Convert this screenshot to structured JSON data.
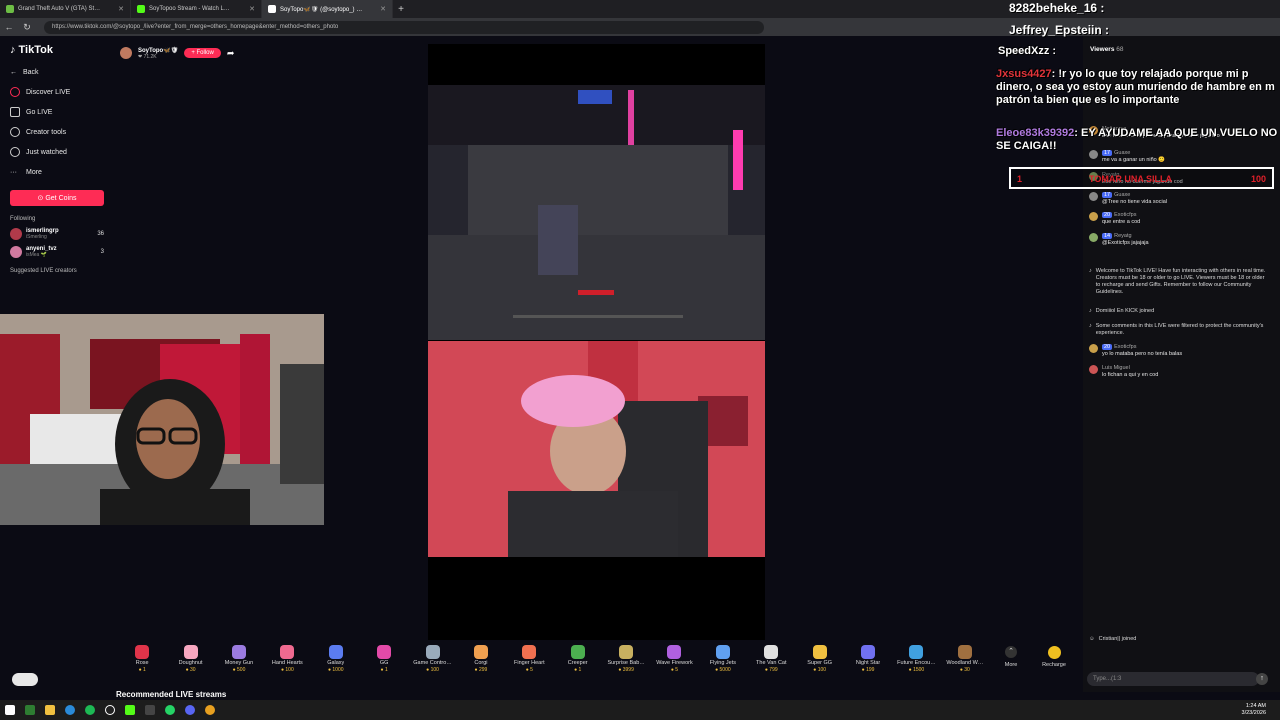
{
  "browser": {
    "tabs": [
      {
        "label": "Grand Theft Auto V (GTA) St…",
        "color": "#6dbd45"
      },
      {
        "label": "SoyTopoo Stream - Watch L…",
        "color": "#53fc18"
      },
      {
        "label": "SoyTopo🦋🛡 (@soytopo_) …",
        "color": "#ffffff"
      }
    ],
    "new_tab": "+",
    "url": "https://www.tiktok.com/@soytopo_/live?enter_from_merge=others_homepage&enter_method=others_photo"
  },
  "sidebar": {
    "logo": "TikTok",
    "back": "Back",
    "items": [
      "Discover LIVE",
      "Go LIVE",
      "Creator tools",
      "Just watched",
      "More"
    ],
    "get_coins": "Get Coins",
    "following_title": "Following",
    "following": [
      {
        "name": "ismerlingrp",
        "sub": "iSmerling",
        "count": "36"
      },
      {
        "name": "anyeni_tvz",
        "sub": "isMea 🌱",
        "count": "3"
      }
    ],
    "suggested_title": "Suggested LIVE creators"
  },
  "host": {
    "name": "SoyTopo🦋🛡",
    "likes": "❤ 71.2K",
    "follow_label": "+ Follow"
  },
  "top_overlay": [
    {
      "text": "8282beheke_16 :",
      "color": "#ffffff"
    },
    {
      "text": "Jeffrey_Epsteiin :",
      "color": "#ffffff"
    }
  ],
  "overlay_chat": [
    {
      "name": "SpeedXzz :",
      "text": "",
      "name_color": "#ffffff"
    },
    {
      "name": "Jxsus4427",
      "text": ": !r yo lo que toy relajado porque mi p dinero, o sea yo estoy aun muriendo de hambre en m patrón ta bien que es lo importante",
      "name_color": "#e0343a"
    },
    {
      "name": "Eleoe83k39392",
      "text": ": EY AYUDAME AA QUE UN VUELO NO SE CAIGA!!",
      "name_color": "#b07be0"
    }
  ],
  "overlay_box": {
    "left": "1",
    "middle": "TOMAR UNA SILLA",
    "right": "100"
  },
  "chat": {
    "viewers_label": "Viewers",
    "viewers_count": "68",
    "messages": [
      {
        "level": "",
        "user": "Matigame",
        "text": "Ese niño a lo mejor se la pasa 24 horas jugando",
        "color": "#c58a3a"
      },
      {
        "level": "17",
        "user": "Guaxe",
        "text": "me va a ganar un niño 🙂",
        "color": "#888"
      },
      {
        "level": "",
        "user": "Reyatg",
        "text": "Ese niño no duerme jugando cod",
        "color": "#8a6"
      },
      {
        "level": "17",
        "user": "Guaxe",
        "text": "@Tree no tiene vida social",
        "color": "#888"
      },
      {
        "level": "20",
        "user": "Exoticfps",
        "text": "que entre a cod",
        "color": "#c9a04a"
      },
      {
        "level": "14",
        "user": "Reyatg",
        "text": "@Exoticfps jajajaja",
        "color": "#8a6"
      }
    ],
    "welcome": "Welcome to TikTok LIVE! Have fun interacting with others in real time. Creators must be 18 or older to go LIVE. Viewers must be 18 or older to recharge and send Gifts. Remember to follow our Community Guidelines.",
    "joined1": "Domiiiol En KICK joined",
    "filtered": "Some comments in this LIVE were filtered to protect the community's experience.",
    "after": [
      {
        "level": "20",
        "user": "Exoticfps",
        "text": "yo lo mataba pero no tenía balas",
        "color": "#c9a04a"
      },
      {
        "level": "",
        "user": "Luis Miguel",
        "text": "lo fichan a qui y en cod",
        "color": "#c55"
      }
    ],
    "joined2": "Cristian|| joined",
    "input_placeholder": "Type...(1:3"
  },
  "gifts": [
    {
      "name": "Rose",
      "price": "1",
      "color": "#e0344a"
    },
    {
      "name": "Doughnut",
      "price": "30",
      "color": "#f7a7c0"
    },
    {
      "name": "Money Gun",
      "price": "500",
      "color": "#9b7be0"
    },
    {
      "name": "Hand Hearts",
      "price": "100",
      "color": "#f06a90"
    },
    {
      "name": "Galaxy",
      "price": "1000",
      "color": "#5b7cf0"
    },
    {
      "name": "GG",
      "price": "1",
      "color": "#e34aa8"
    },
    {
      "name": "Game Contro…",
      "price": "100",
      "color": "#9ab"
    },
    {
      "name": "Corgi",
      "price": "299",
      "color": "#f0a050"
    },
    {
      "name": "Finger Heart",
      "price": "5",
      "color": "#f07050"
    },
    {
      "name": "Creeper",
      "price": "1",
      "color": "#4caf50"
    },
    {
      "name": "Surprise Bab…",
      "price": "3999",
      "color": "#c8b060"
    },
    {
      "name": "Wave Firework",
      "price": "5",
      "color": "#b060e0"
    },
    {
      "name": "Flying Jets",
      "price": "5000",
      "color": "#60a0f0"
    },
    {
      "name": "The Van Cat",
      "price": "799",
      "color": "#e0e0e0"
    },
    {
      "name": "Super GG",
      "price": "100",
      "color": "#f0c040"
    },
    {
      "name": "Night Star",
      "price": "199",
      "color": "#7070f0"
    },
    {
      "name": "Future Encou…",
      "price": "1500",
      "color": "#40a0e0"
    },
    {
      "name": "Woodland W…",
      "price": "30",
      "color": "#a07040"
    }
  ],
  "more_label": "More",
  "recharge_label": "Recharge",
  "recommended": "Recommended LIVE streams",
  "clock": {
    "time": "1:24 AM",
    "date": "3/23/2026"
  }
}
